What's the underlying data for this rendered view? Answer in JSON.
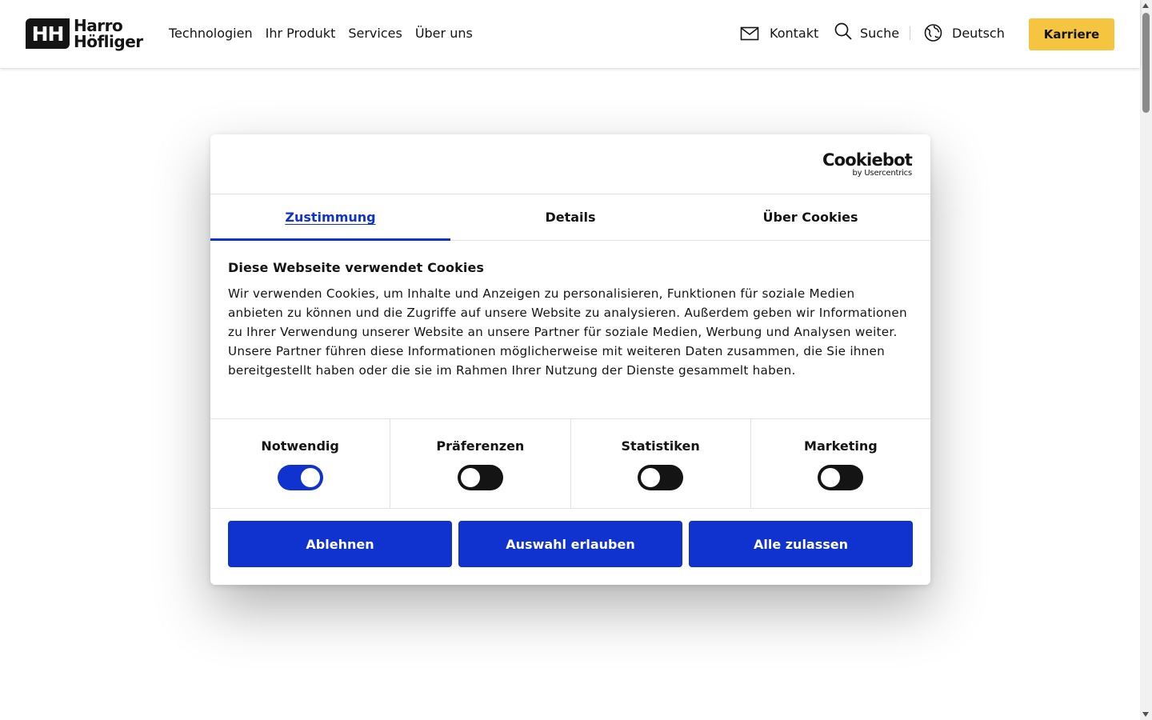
{
  "header": {
    "logo": {
      "mark": "HH",
      "line1": "Harro",
      "line2": "Höfliger"
    },
    "nav": [
      "Technologien",
      "Ihr Produkt",
      "Services",
      "Über uns"
    ],
    "contact_label": "Kontakt",
    "search_label": "Suche",
    "language_label": "Deutsch",
    "career_button": "Karriere",
    "icons": {
      "contact": "mail-icon",
      "search": "search-icon",
      "language": "globe-icon"
    },
    "accent_color": "#f5c542"
  },
  "cookie_dialog": {
    "brand": {
      "name": "Cookiebot",
      "sub": "by Usercentrics"
    },
    "tabs": [
      {
        "label": "Zustimmung",
        "active": true
      },
      {
        "label": "Details",
        "active": false
      },
      {
        "label": "Über Cookies",
        "active": false
      }
    ],
    "heading": "Diese Webseite verwendet Cookies",
    "text": "Wir verwenden Cookies, um Inhalte und Anzeigen zu personalisieren, Funktionen für soziale Medien anbieten zu können und die Zugriffe auf unsere Website zu analysieren. Außerdem geben wir Informationen zu Ihrer Verwendung unserer Website an unsere Partner für soziale Medien, Werbung und Analysen weiter. Unsere Partner führen diese Informationen möglicherweise mit weiteren Daten zusammen, die Sie ihnen bereitgestellt haben oder die sie im Rahmen Ihrer Nutzung der Dienste gesammelt haben.",
    "toggles": [
      {
        "label": "Notwendig",
        "on": true
      },
      {
        "label": "Präferenzen",
        "on": false
      },
      {
        "label": "Statistiken",
        "on": false
      },
      {
        "label": "Marketing",
        "on": false
      }
    ],
    "buttons": {
      "decline": "Ablehnen",
      "allow_selection": "Auswahl erlauben",
      "allow_all": "Alle zulassen"
    },
    "accent_color": "#1032cf"
  }
}
